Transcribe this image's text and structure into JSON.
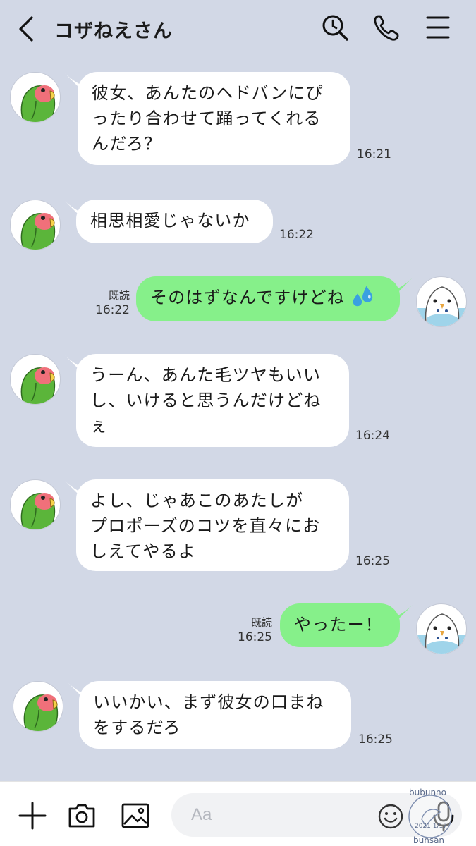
{
  "header": {
    "title": "コザねえさん",
    "icons": [
      "back-chevron-icon",
      "search-icon",
      "phone-icon",
      "menu-icon"
    ]
  },
  "messages": [
    {
      "side": "in",
      "text": [
        "彼女、あんたのヘドバンにぴ",
        "ったり合わせて踊ってくれる",
        "んだろ？"
      ],
      "time": "16:21"
    },
    {
      "side": "in",
      "text": [
        "相思相愛じゃないか"
      ],
      "time": "16:22"
    },
    {
      "side": "out",
      "text": [
        "そのはずなんですけどね"
      ],
      "emoji": "sweat-droplets-icon",
      "read": "既読",
      "time": "16:22"
    },
    {
      "side": "in",
      "text": [
        "うーん、あんた毛ツヤもいい",
        "し、いけると思うんだけどね",
        "ぇ"
      ],
      "time": "16:24"
    },
    {
      "side": "in",
      "text": [
        "よし、じゃあこのあたしが",
        "プロポーズのコツを直々にお",
        "しえてやるよ"
      ],
      "time": "16:25"
    },
    {
      "side": "out",
      "text": [
        "やったー！"
      ],
      "read": "既読",
      "time": "16:25"
    },
    {
      "side": "in",
      "text": [
        "いいかい、まず彼女の口まね",
        "をするだろ"
      ],
      "time": "16:25"
    }
  ],
  "composer": {
    "placeholder": "Aa",
    "icons": [
      "plus-icon",
      "camera-icon",
      "image-icon",
      "emoji-icon",
      "microphone-icon"
    ]
  },
  "watermark": {
    "text_top": "bubunno",
    "text_bottom": "bunsan",
    "date": "2021 1/17"
  },
  "colors": {
    "background": "#d2d8e6",
    "incoming_bubble": "#ffffff",
    "outgoing_bubble": "#86f08a",
    "lovebird_green": "#5bb53a",
    "lovebird_face": "#f0707a",
    "budgie_blue": "#9fd4ea"
  }
}
